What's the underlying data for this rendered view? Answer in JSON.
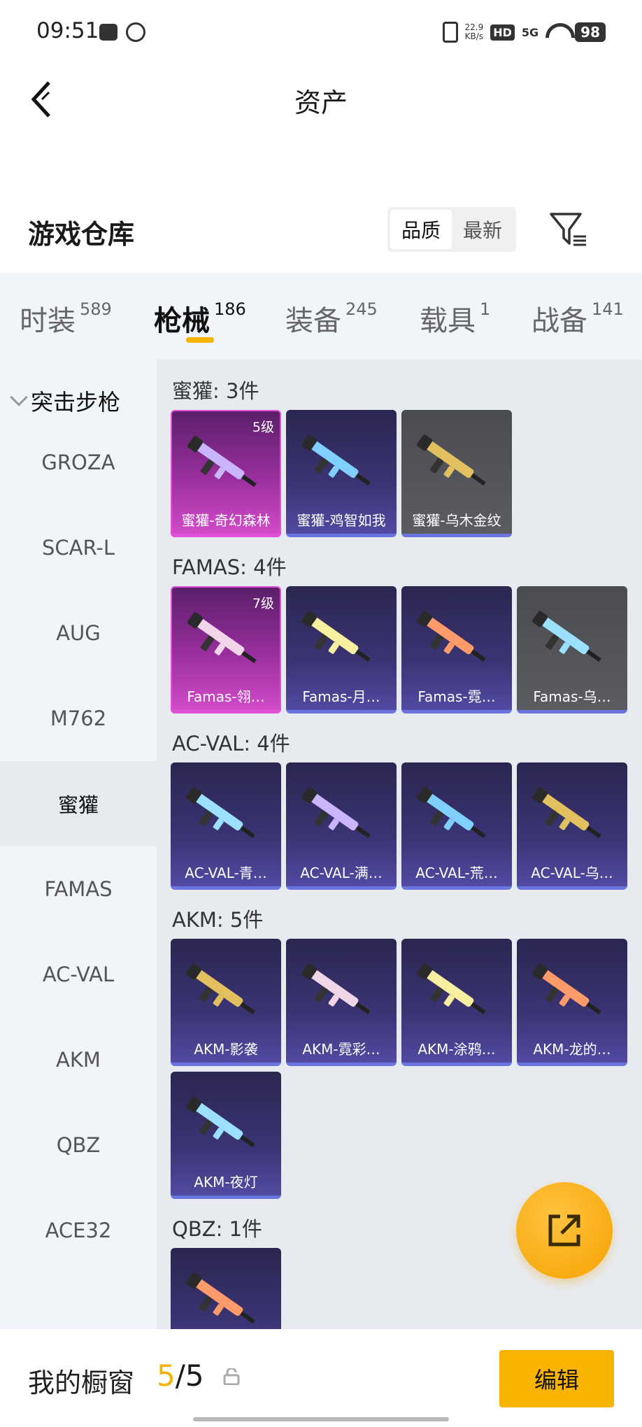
{
  "status_bar": {
    "time": "09:51",
    "net_speed": "22.9",
    "net_unit": "KB/s",
    "hd": "HD",
    "signal": "5G",
    "battery": "98"
  },
  "header": {
    "title": "资产"
  },
  "warehouse": {
    "title": "游戏仓库",
    "sort_options": [
      "品质",
      "最新"
    ],
    "active_sort": "品质"
  },
  "tabs": [
    {
      "label": "时装",
      "count": "589"
    },
    {
      "label": "枪械",
      "count": "186"
    },
    {
      "label": "装备",
      "count": "245"
    },
    {
      "label": "载具",
      "count": "1"
    },
    {
      "label": "战备",
      "count": "141"
    }
  ],
  "sidebar": {
    "category": "突击步枪",
    "items": [
      "GROZA",
      "SCAR-L",
      "AUG",
      "M762",
      "蜜獾",
      "FAMAS",
      "AC-VAL",
      "AKM",
      "QBZ",
      "ACE32"
    ],
    "active": "蜜獾"
  },
  "groups": [
    {
      "title": "蜜獾: 3件",
      "items": [
        {
          "name": "蜜獾-奇幻森林",
          "level": "5级",
          "rarity": "pink"
        },
        {
          "name": "蜜獾-鸡智如我",
          "level": "",
          "rarity": "purple"
        },
        {
          "name": "蜜獾-乌木金纹",
          "level": "",
          "rarity": "gray"
        }
      ]
    },
    {
      "title": "FAMAS: 4件",
      "items": [
        {
          "name": "Famas-翎…",
          "level": "7级",
          "rarity": "pink"
        },
        {
          "name": "Famas-月…",
          "level": "",
          "rarity": "purple"
        },
        {
          "name": "Famas-霓…",
          "level": "",
          "rarity": "purple"
        },
        {
          "name": "Famas-乌…",
          "level": "",
          "rarity": "gray"
        }
      ]
    },
    {
      "title": "AC-VAL: 4件",
      "items": [
        {
          "name": "AC-VAL-青…",
          "level": "",
          "rarity": "purple"
        },
        {
          "name": "AC-VAL-满…",
          "level": "",
          "rarity": "purple"
        },
        {
          "name": "AC-VAL-荒…",
          "level": "",
          "rarity": "purple"
        },
        {
          "name": "AC-VAL-乌…",
          "level": "",
          "rarity": "purple"
        }
      ]
    },
    {
      "title": "AKM: 5件",
      "items": [
        {
          "name": "AKM-影袭",
          "level": "",
          "rarity": "purple"
        },
        {
          "name": "AKM-霓彩…",
          "level": "",
          "rarity": "purple"
        },
        {
          "name": "AKM-涂鸦…",
          "level": "",
          "rarity": "purple"
        },
        {
          "name": "AKM-龙的…",
          "level": "",
          "rarity": "purple"
        },
        {
          "name": "AKM-夜灯",
          "level": "",
          "rarity": "purple"
        }
      ]
    },
    {
      "title": "QBZ: 1件",
      "items": [
        {
          "name": "",
          "level": "",
          "rarity": "purple"
        }
      ]
    }
  ],
  "bottom_bar": {
    "label": "我的橱窗",
    "current": "5",
    "total": "/5",
    "edit_label": "编辑"
  },
  "colors": {
    "accent": "#f5b400",
    "pink_rarity": "#e050d8",
    "purple_rarity": "#6a75e0",
    "tab_bg": "#f1f4f8",
    "content_bg": "#e7ebf0"
  }
}
